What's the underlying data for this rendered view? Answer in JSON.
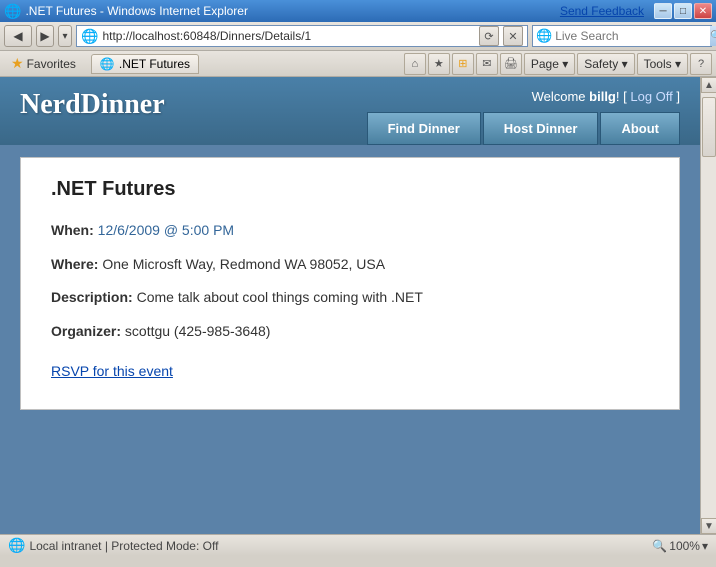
{
  "titlebar": {
    "title": ".NET Futures - Windows Internet Explorer",
    "send_feedback": "Send Feedback",
    "min_btn": "─",
    "max_btn": "□",
    "close_btn": "✕"
  },
  "addressbar": {
    "url": "http://localhost:60848/Dinners/Details/1",
    "ie_icon": "🌐",
    "refresh": "⟳",
    "stop": "✕"
  },
  "searchbar": {
    "placeholder": "Live Search",
    "icon": "🔍"
  },
  "favbar": {
    "favorites_label": "Favorites",
    "tab_label": ".NET Futures"
  },
  "toolbar_icons": {
    "home": "⌂",
    "page": "Page ▾",
    "safety": "Safety ▾",
    "tools": "Tools ▾",
    "help": "?"
  },
  "app": {
    "logo": "NerdDinner",
    "welcome": "Welcome ",
    "username": "billg",
    "exclamation": "!",
    "log_off_bracket_open": "[ ",
    "log_off": "Log Off",
    "log_off_bracket_close": " ]",
    "nav": {
      "find_dinner": "Find Dinner",
      "host_dinner": "Host Dinner",
      "about": "About"
    }
  },
  "dinner": {
    "title": ".NET Futures",
    "when_label": "When:",
    "when_value": "12/6/2009 @ 5:00 PM",
    "where_label": "Where:",
    "where_value": "One Microsft Way, Redmond WA 98052, USA",
    "description_label": "Description:",
    "description_value": "Come talk about cool things coming with .NET",
    "organizer_label": "Organizer:",
    "organizer_value": "scottgu (425-985-3648)",
    "rsvp_link": "RSVP for this event"
  },
  "statusbar": {
    "zone": "Local intranet | Protected Mode: Off",
    "zoom": "🔍 100%",
    "zoom_arrow": "▾"
  }
}
